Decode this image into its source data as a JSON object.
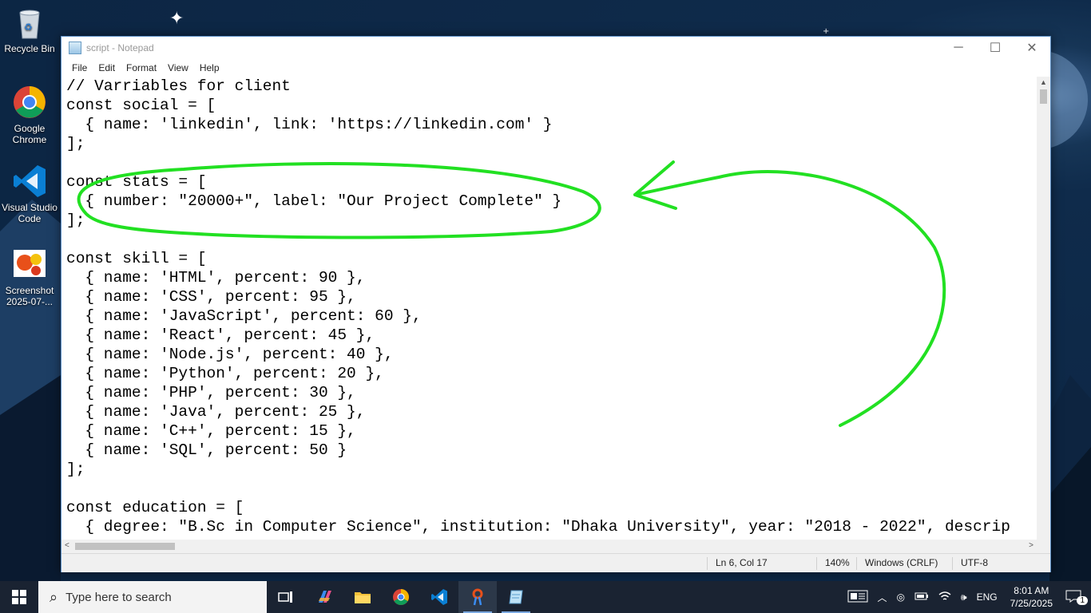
{
  "desktop": {
    "icons": [
      {
        "label": "Recycle Bin"
      },
      {
        "label": "Google Chrome"
      },
      {
        "label": "Visual Studio Code"
      },
      {
        "label": "Screenshot 2025-07-..."
      }
    ]
  },
  "window": {
    "title": "script - Notepad",
    "menu": [
      "File",
      "Edit",
      "Format",
      "View",
      "Help"
    ],
    "code": "// Varriables for client\nconst social = [\n  { name: 'linkedin', link: 'https://linkedin.com' }\n];\n\nconst stats = [\n  { number: \"20000+\", label: \"Our Project Complete\" }\n];\n\nconst skill = [\n  { name: 'HTML', percent: 90 },\n  { name: 'CSS', percent: 95 },\n  { name: 'JavaScript', percent: 60 },\n  { name: 'React', percent: 45 },\n  { name: 'Node.js', percent: 40 },\n  { name: 'Python', percent: 20 },\n  { name: 'PHP', percent: 30 },\n  { name: 'Java', percent: 25 },\n  { name: 'C++', percent: 15 },\n  { name: 'SQL', percent: 50 }\n];\n\nconst education = [\n  { degree: \"B.Sc in Computer Science\", institution: \"Dhaka University\", year: \"2018 - 2022\", descrip",
    "status": {
      "position": "Ln 6, Col 17",
      "zoom": "140%",
      "line_ending": "Windows (CRLF)",
      "encoding": "UTF-8"
    }
  },
  "annotation": {
    "color": "#22e022"
  },
  "taskbar": {
    "search_placeholder": "Type here to search",
    "language": "ENG",
    "time": "8:01 AM",
    "date": "7/25/2025",
    "notification_count": "1"
  }
}
